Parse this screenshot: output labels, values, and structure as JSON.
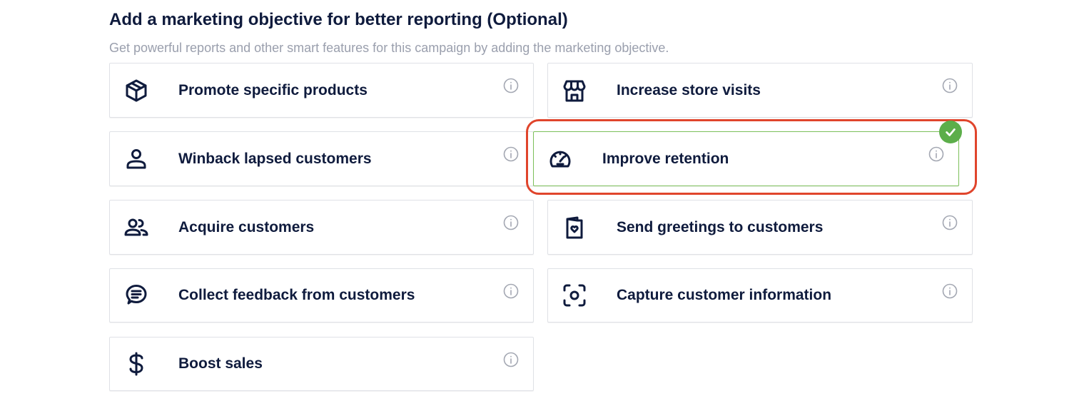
{
  "header": {
    "title": "Add a marketing objective for better reporting (Optional)",
    "subtitle": "Get powerful reports and other smart features for this campaign by adding the marketing objective."
  },
  "objectives": [
    {
      "label": "Promote specific products",
      "icon": "box-icon",
      "selected": false
    },
    {
      "label": "Increase store visits",
      "icon": "store-icon",
      "selected": false
    },
    {
      "label": "Winback lapsed customers",
      "icon": "user-icon",
      "selected": false
    },
    {
      "label": "Improve retention",
      "icon": "speedometer-icon",
      "selected": true
    },
    {
      "label": "Acquire customers",
      "icon": "users-icon",
      "selected": false
    },
    {
      "label": "Send greetings to customers",
      "icon": "greeting-card-icon",
      "selected": false
    },
    {
      "label": "Collect feedback from customers",
      "icon": "chat-bubble-icon",
      "selected": false
    },
    {
      "label": "Capture customer information",
      "icon": "scan-icon",
      "selected": false
    },
    {
      "label": "Boost sales",
      "icon": "dollar-icon",
      "selected": false
    }
  ],
  "colors": {
    "text_primary": "#0f1b3d",
    "text_secondary": "#9a9fad",
    "selected_border": "#7cbf5a",
    "check_badge": "#5cae4a",
    "highlight_annotation": "#e0452c"
  }
}
